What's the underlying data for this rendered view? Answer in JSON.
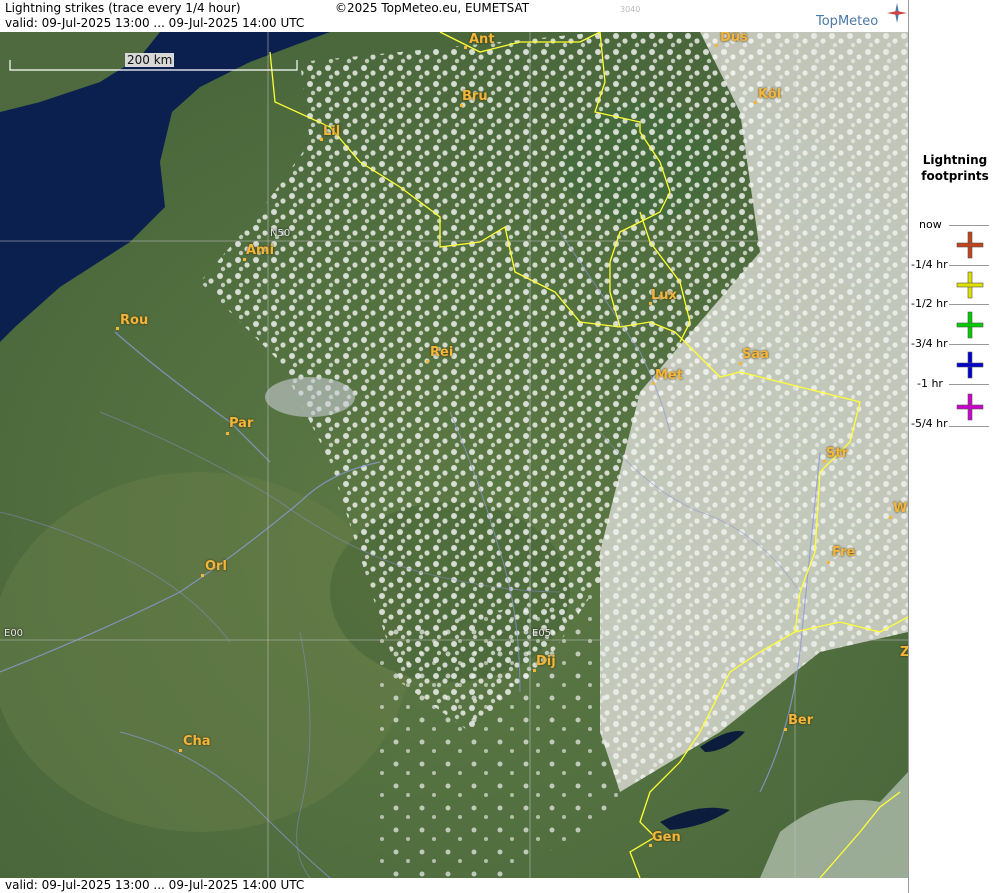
{
  "header": {
    "title": "Lightning strikes (trace every 1/4 hour)",
    "valid": "valid:  09-Jul-2025 13:00 ... 09-Jul-2025 14:00 UTC",
    "copyright": "©2025 TopMeteo.eu, EUMETSAT",
    "code": "3040",
    "brand": "TopMeteo"
  },
  "footer": {
    "valid": "valid:  09-Jul-2025 13:00 ... 09-Jul-2025 14:00 UTC"
  },
  "map": {
    "scale_label": "200 km",
    "grid_labels": {
      "lat": "N50",
      "lon0": "E00",
      "lon5": "E05"
    },
    "cities": {
      "ant": "Ant",
      "dus": "Düs",
      "bru": "Bru",
      "kol": "Köl",
      "lil": "Lil",
      "ami": "Ami",
      "rou": "Rou",
      "lux": "Lux",
      "rei": "Rei",
      "saa": "Saa",
      "met": "Met",
      "par": "Par",
      "str": "Str",
      "w": "W",
      "fre": "Fre",
      "orl": "Orl",
      "dij": "Dij",
      "z": "Z",
      "ber": "Ber",
      "cha": "Cha",
      "gen": "Gen"
    }
  },
  "legend": {
    "title": "Lightning footprints",
    "rows": [
      {
        "label": "now",
        "color": ""
      },
      {
        "label": "-1/4 hr",
        "color": "#c0441a"
      },
      {
        "label": "-1/2 hr",
        "color": "#e0e000"
      },
      {
        "label": "-3/4 hr",
        "color": "#00cc00"
      },
      {
        "label": "-1 hr",
        "color": "#0000cc"
      },
      {
        "label": "-5/4 hr",
        "color": "#cc00cc"
      }
    ]
  }
}
